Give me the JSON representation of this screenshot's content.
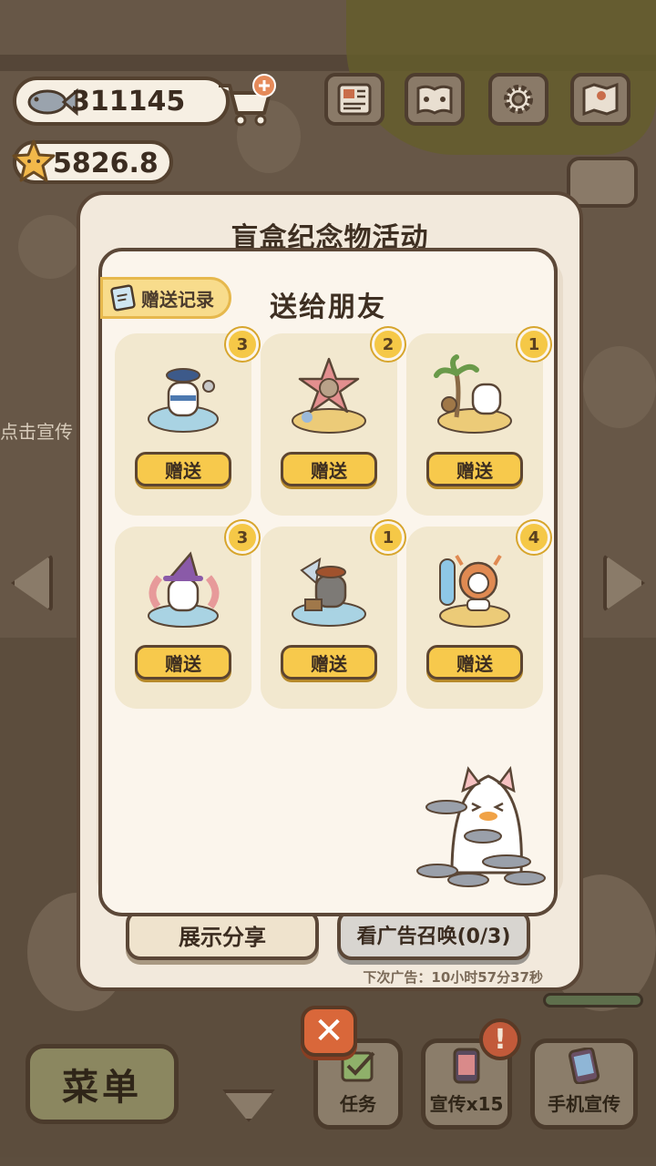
{
  "hud": {
    "fish_count": "311145",
    "star_count": "5826.8",
    "fish_icon": "fish-icon",
    "star_icon": "star-icon",
    "cart_icon": "cart-plus-icon"
  },
  "top_icons": [
    "newspaper-icon",
    "paw-book-icon",
    "gear-icon",
    "map-icon"
  ],
  "background": {
    "side_text": "点击宣传"
  },
  "modal": {
    "title": "盲盒纪念物活动",
    "share_label": "展示分享",
    "ad_label": "看广告召唤(0/3)",
    "next_ad_text": "下次广告：10小时57分37秒"
  },
  "panel": {
    "title": "送给朋友",
    "record_label": "赠送记录",
    "items": [
      {
        "count": "3",
        "give_label": "赠送",
        "art": "sailor-cat-souvenir"
      },
      {
        "count": "2",
        "give_label": "赠送",
        "art": "starfish-cat-souvenir"
      },
      {
        "count": "1",
        "give_label": "赠送",
        "art": "palm-island-cat-souvenir"
      },
      {
        "count": "3",
        "give_label": "赠送",
        "art": "witch-cat-souvenir"
      },
      {
        "count": "1",
        "give_label": "赠送",
        "art": "pirate-raccoon-souvenir"
      },
      {
        "count": "4",
        "give_label": "赠送",
        "art": "surfer-crab-cat-souvenir"
      }
    ]
  },
  "bottom": {
    "close_label": "✕",
    "menu_label": "菜单",
    "task_label": "任务",
    "promo_label": "宣传x15",
    "phone_label": "手机宣传",
    "alert_label": "!"
  },
  "colors": {
    "button_yellow": "#f7c94c",
    "badge_gold": "#f5c847",
    "panel_bg": "#fbf5ec",
    "close_orange": "#d9673a"
  }
}
